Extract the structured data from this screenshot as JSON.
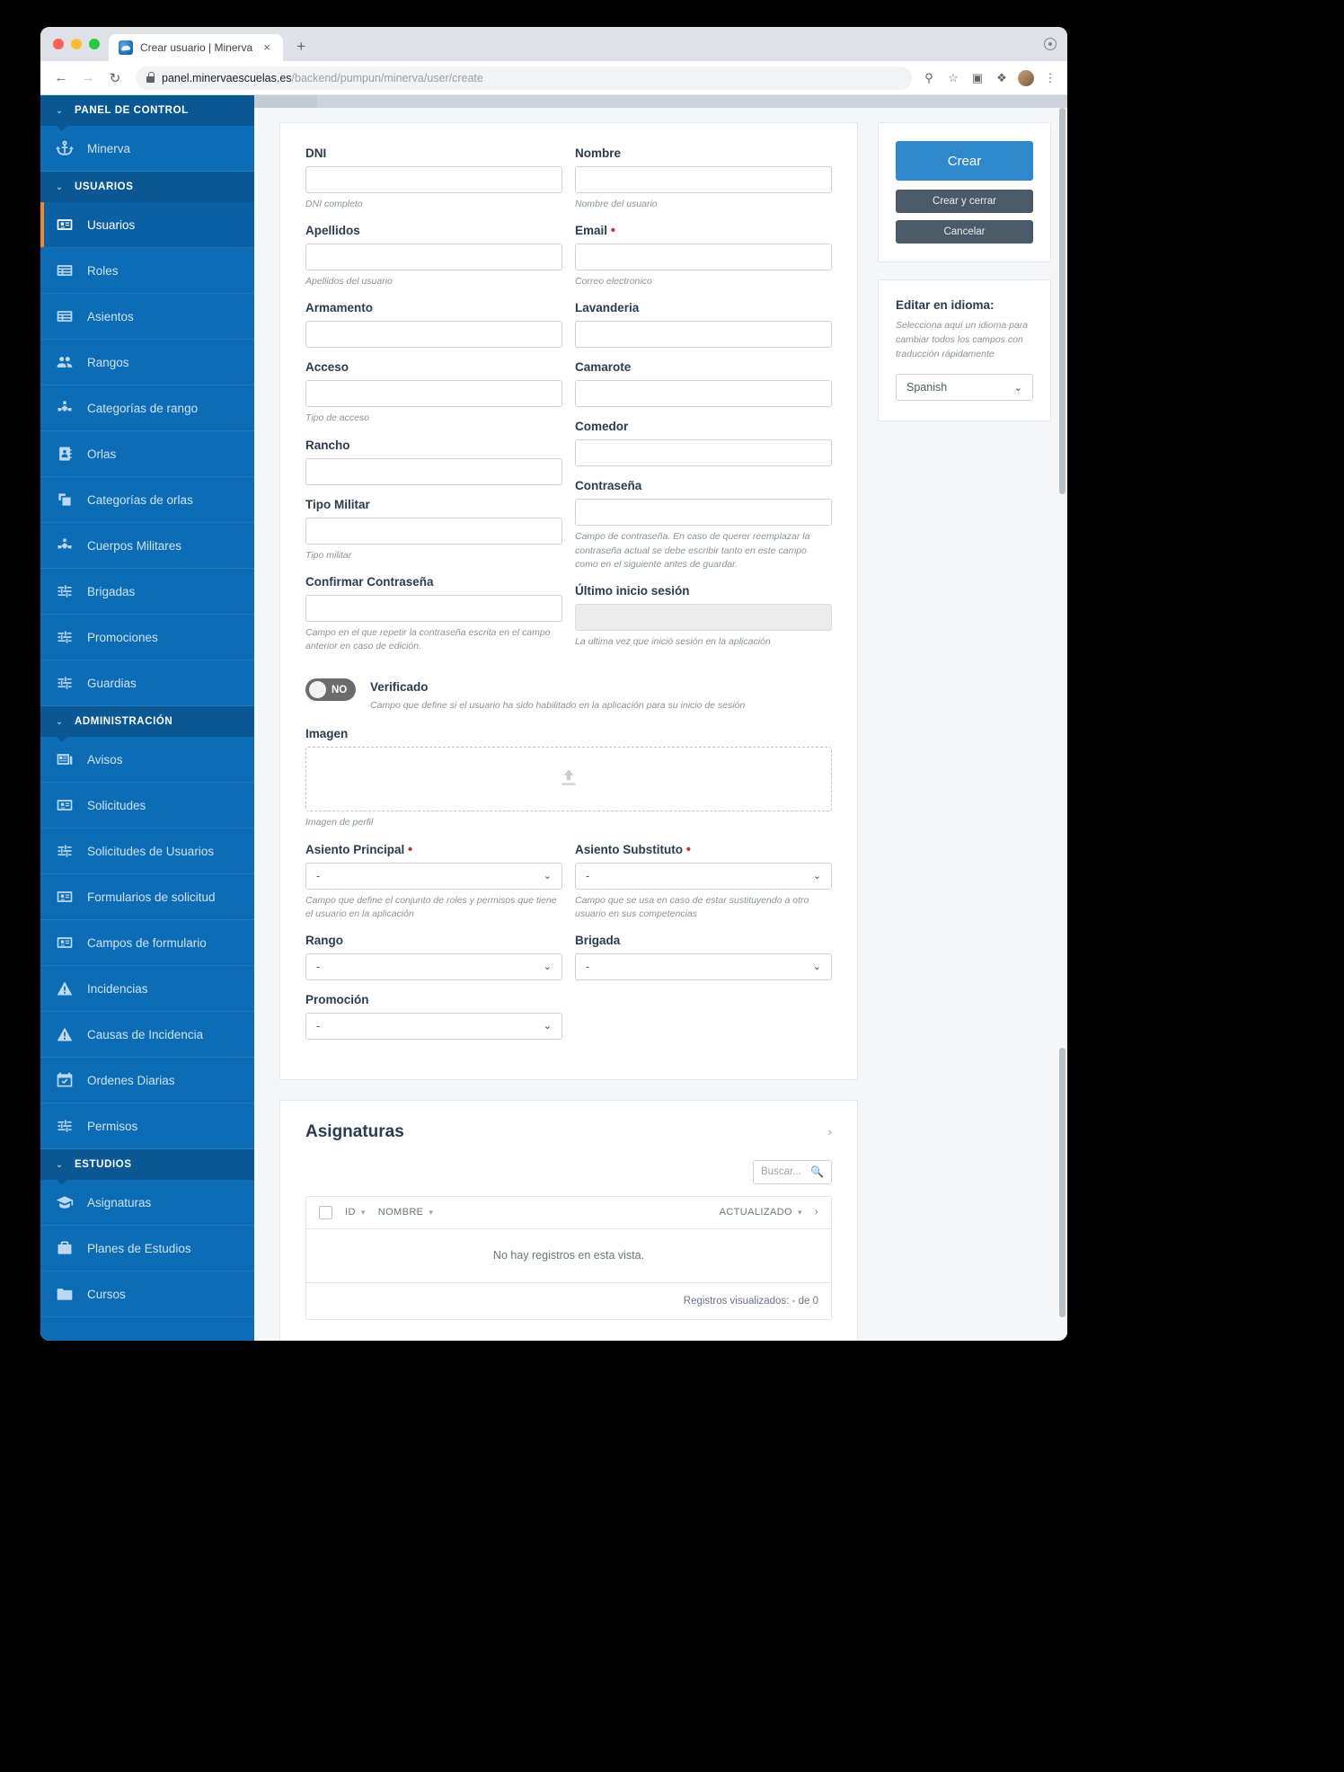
{
  "browser": {
    "tab_title": "Crear usuario | Minerva",
    "close_label": "×",
    "newtab_label": "+",
    "back_label": "←",
    "forward_label": "→",
    "reload_label": "↻",
    "url_host": "panel.minervaescuelas.es",
    "url_path": "/backend/pumpun/minerva/user/create",
    "menu_label": "⋮"
  },
  "sidebar": {
    "groups": [
      {
        "header": "PANEL DE CONTROL",
        "items": [
          {
            "label": "Minerva",
            "icon": "anchor-icon",
            "active": false
          }
        ]
      },
      {
        "header": "USUARIOS",
        "items": [
          {
            "label": "Usuarios",
            "icon": "id-card-icon",
            "active": true
          },
          {
            "label": "Roles",
            "icon": "list-box-icon",
            "active": false
          },
          {
            "label": "Asientos",
            "icon": "list-box-icon",
            "active": false
          },
          {
            "label": "Rangos",
            "icon": "users-icon",
            "active": false
          },
          {
            "label": "Categorías de rango",
            "icon": "sitemap-icon",
            "active": false
          },
          {
            "label": "Orlas",
            "icon": "contact-book-icon",
            "active": false
          },
          {
            "label": "Categorías de orlas",
            "icon": "clone-icon",
            "active": false
          },
          {
            "label": "Cuerpos Militares",
            "icon": "sitemap-icon",
            "active": false
          },
          {
            "label": "Brigadas",
            "icon": "sliders-icon",
            "active": false
          },
          {
            "label": "Promociones",
            "icon": "sliders-icon",
            "active": false
          },
          {
            "label": "Guardias",
            "icon": "sliders-icon",
            "active": false
          }
        ]
      },
      {
        "header": "ADMINISTRACIÓN",
        "items": [
          {
            "label": "Avisos",
            "icon": "newspaper-icon",
            "active": false
          },
          {
            "label": "Solicitudes",
            "icon": "id-card-icon",
            "active": false
          },
          {
            "label": "Solicitudes de Usuarios",
            "icon": "sliders-icon",
            "active": false
          },
          {
            "label": "Formularios de solicitud",
            "icon": "id-card-icon",
            "active": false
          },
          {
            "label": "Campos de formulario",
            "icon": "id-card-icon",
            "active": false
          },
          {
            "label": "Incidencias",
            "icon": "warning-icon",
            "active": false
          },
          {
            "label": "Causas de Incidencia",
            "icon": "warning-icon",
            "active": false
          },
          {
            "label": "Ordenes Diarias",
            "icon": "calendar-check-icon",
            "active": false
          },
          {
            "label": "Permisos",
            "icon": "sliders-icon",
            "active": false
          }
        ]
      },
      {
        "header": "ESTUDIOS",
        "items": [
          {
            "label": "Asignaturas",
            "icon": "graduation-cap-icon",
            "active": false
          },
          {
            "label": "Planes de Estudios",
            "icon": "briefcase-icon",
            "active": false
          },
          {
            "label": "Cursos",
            "icon": "folder-icon",
            "active": false
          }
        ]
      }
    ]
  },
  "form": {
    "fields": [
      {
        "label": "DNI",
        "help": "DNI completo",
        "type": "text",
        "value": "",
        "required": false,
        "col": "left"
      },
      {
        "label": "Nombre",
        "help": "Nombre del usuario",
        "type": "text",
        "value": "",
        "required": false,
        "col": "right"
      },
      {
        "label": "Apellidos",
        "help": "Apellidos del usuario",
        "type": "text",
        "value": "",
        "required": false,
        "col": "left"
      },
      {
        "label": "Email",
        "help": "Correo electronico",
        "type": "text",
        "value": "",
        "required": true,
        "col": "right"
      },
      {
        "label": "Armamento",
        "help": "",
        "type": "text",
        "value": "",
        "required": false,
        "col": "left"
      },
      {
        "label": "Lavanderia",
        "help": "",
        "type": "text",
        "value": "",
        "required": false,
        "col": "right"
      },
      {
        "label": "Acceso",
        "help": "Tipo de acceso",
        "type": "text",
        "value": "",
        "required": false,
        "col": "left"
      },
      {
        "label": "Camarote",
        "help": "",
        "type": "text",
        "value": "",
        "required": false,
        "col": "right"
      },
      {
        "label": "Rancho",
        "help": "",
        "type": "text",
        "value": "",
        "required": false,
        "col": "left"
      },
      {
        "label": "Comedor",
        "help": "",
        "type": "text",
        "value": "",
        "required": false,
        "col": "right"
      },
      {
        "label": "Tipo Militar",
        "help": "Tipo militar",
        "type": "text",
        "value": "",
        "required": false,
        "col": "left"
      },
      {
        "label": "Contraseña",
        "help": "Campo de contraseña. En caso de querer reemplazar la contraseña actual se debe escribir tanto en este campo como en el siguiente antes de guardar.",
        "type": "text",
        "value": "",
        "required": false,
        "col": "right"
      },
      {
        "label": "Confirmar Contraseña",
        "help": "Campo en el que repetir la contraseña escrita en el campo anterior en caso de edición.",
        "type": "text",
        "value": "",
        "required": false,
        "col": "left"
      },
      {
        "label": "Último inicio sesión",
        "help": "La ultima vez que inició sesión en la aplicación",
        "type": "text-disabled",
        "value": "",
        "required": false,
        "col": "right"
      }
    ],
    "toggle": {
      "state_label": "NO",
      "title": "Verificado",
      "help": "Campo que define si el usuario ha sido habilitado en la aplicación para su inicio de sesión"
    },
    "image": {
      "label": "Imagen",
      "help": "Imagen de perfil",
      "icon": "upload-icon"
    },
    "selects": [
      {
        "label": "Asiento Principal",
        "required": true,
        "value": "-",
        "help": "Campo que define el conjunto de roles y permisos que tiene el usuario en la aplicación",
        "col": "left"
      },
      {
        "label": "Asiento Substituto",
        "required": true,
        "value": "-",
        "help": "Campo que se usa en caso de estar sustituyendo a otro usuario en sus competencias",
        "col": "right"
      },
      {
        "label": "Rango",
        "required": false,
        "value": "-",
        "help": "",
        "col": "left"
      },
      {
        "label": "Brigada",
        "required": false,
        "value": "-",
        "help": "",
        "col": "right"
      },
      {
        "label": "Promoción",
        "required": false,
        "value": "-",
        "help": "",
        "col": "left"
      }
    ]
  },
  "actions": {
    "create": "Crear",
    "create_and_close": "Crear y cerrar",
    "cancel": "Cancelar"
  },
  "language_panel": {
    "title": "Editar en idioma:",
    "help": "Selecciona aquí un idioma para cambiar todos los campos con traducción rápidamente",
    "selected": "Spanish",
    "chevron": "⌄"
  },
  "asignaturas": {
    "title": "Asignaturas",
    "collapse_icon": "chevron-right-icon",
    "search_placeholder": "Buscar...",
    "search_icon": "magnifier-icon",
    "columns": [
      "ID",
      "NOMBRE",
      "ACTUALIZADO"
    ],
    "empty_message": "No hay registros en esta vista.",
    "footer": "Registros visualizados: - de 0"
  },
  "colors": {
    "sidebar": "#0c6cb5",
    "sidebar_header": "#0a5893",
    "accent_orange": "#f08a24",
    "primary_button": "#2f88cc",
    "secondary_button": "#4b5a69",
    "required_red": "#c0392b"
  }
}
